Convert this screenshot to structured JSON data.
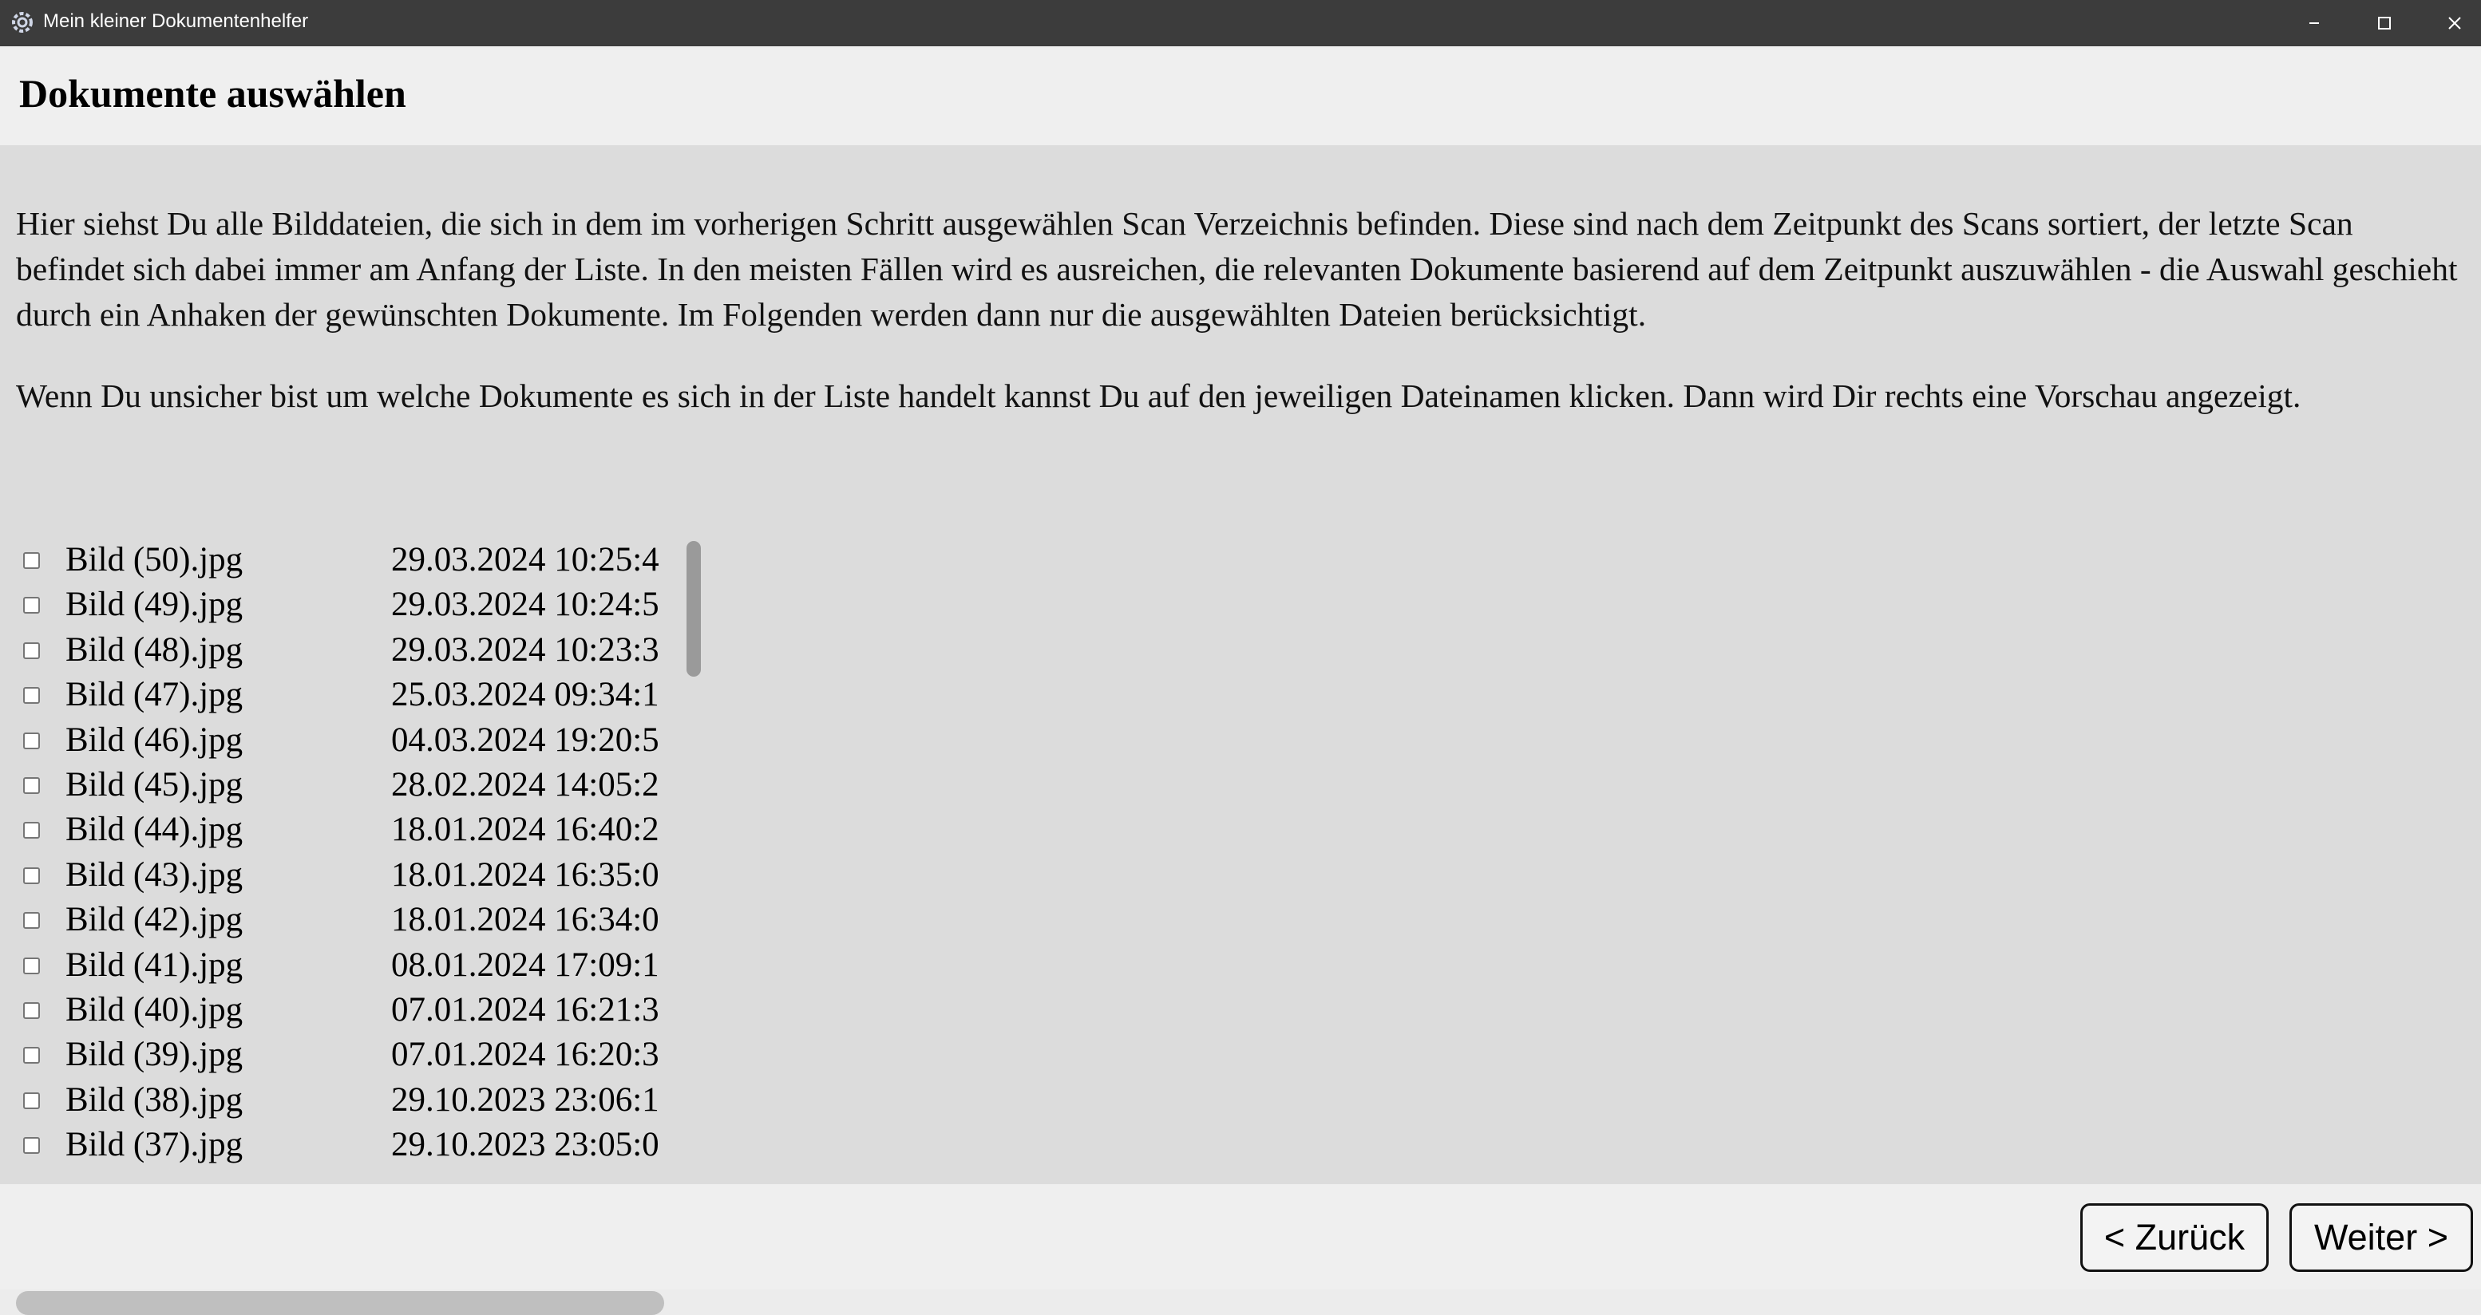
{
  "window": {
    "title": "Mein kleiner Dokumentenhelfer",
    "icons": {
      "app": "gear-icon",
      "minimize": "minimize-icon",
      "maximize": "maximize-icon",
      "close": "close-icon"
    }
  },
  "header": {
    "title": "Dokumente auswählen"
  },
  "main": {
    "paragraph_1": "Hier siehst Du alle Bilddateien, die sich in dem im vorherigen Schritt ausgewählen Scan Verzeichnis befinden. Diese sind nach dem Zeitpunkt des Scans sortiert, der letzte Scan befindet sich dabei immer am Anfang der Liste. In den meisten Fällen wird es ausreichen, die relevanten Dokumente basierend auf dem Zeitpunkt auszuwählen - die Auswahl geschieht durch ein Anhaken der gewünschten Dokumente. Im Folgenden werden dann nur die ausgewählten Dateien berücksichtigt.",
    "paragraph_2": "Wenn Du unsicher bist um welche Dokumente es sich in der Liste handelt kannst Du auf den jeweiligen Dateinamen klicken. Dann wird Dir rechts eine Vorschau angezeigt.",
    "files": [
      {
        "name": "Bild (50).jpg",
        "date": "29.03.2024 10:25:4",
        "checked": false
      },
      {
        "name": "Bild (49).jpg",
        "date": "29.03.2024 10:24:5",
        "checked": false
      },
      {
        "name": "Bild (48).jpg",
        "date": "29.03.2024 10:23:3",
        "checked": false
      },
      {
        "name": "Bild (47).jpg",
        "date": "25.03.2024 09:34:1",
        "checked": false
      },
      {
        "name": "Bild (46).jpg",
        "date": "04.03.2024 19:20:5",
        "checked": false
      },
      {
        "name": "Bild (45).jpg",
        "date": "28.02.2024 14:05:2",
        "checked": false
      },
      {
        "name": "Bild (44).jpg",
        "date": "18.01.2024 16:40:2",
        "checked": false
      },
      {
        "name": "Bild (43).jpg",
        "date": "18.01.2024 16:35:0",
        "checked": false
      },
      {
        "name": "Bild (42).jpg",
        "date": "18.01.2024 16:34:0",
        "checked": false
      },
      {
        "name": "Bild (41).jpg",
        "date": "08.01.2024 17:09:1",
        "checked": false
      },
      {
        "name": "Bild (40).jpg",
        "date": "07.01.2024 16:21:3",
        "checked": false
      },
      {
        "name": "Bild (39).jpg",
        "date": "07.01.2024 16:20:3",
        "checked": false
      },
      {
        "name": "Bild (38).jpg",
        "date": "29.10.2023 23:06:1",
        "checked": false
      },
      {
        "name": "Bild (37).jpg",
        "date": "29.10.2023 23:05:0",
        "checked": false
      }
    ]
  },
  "footer": {
    "back_label": "< Zurück",
    "next_label": "Weiter >"
  }
}
